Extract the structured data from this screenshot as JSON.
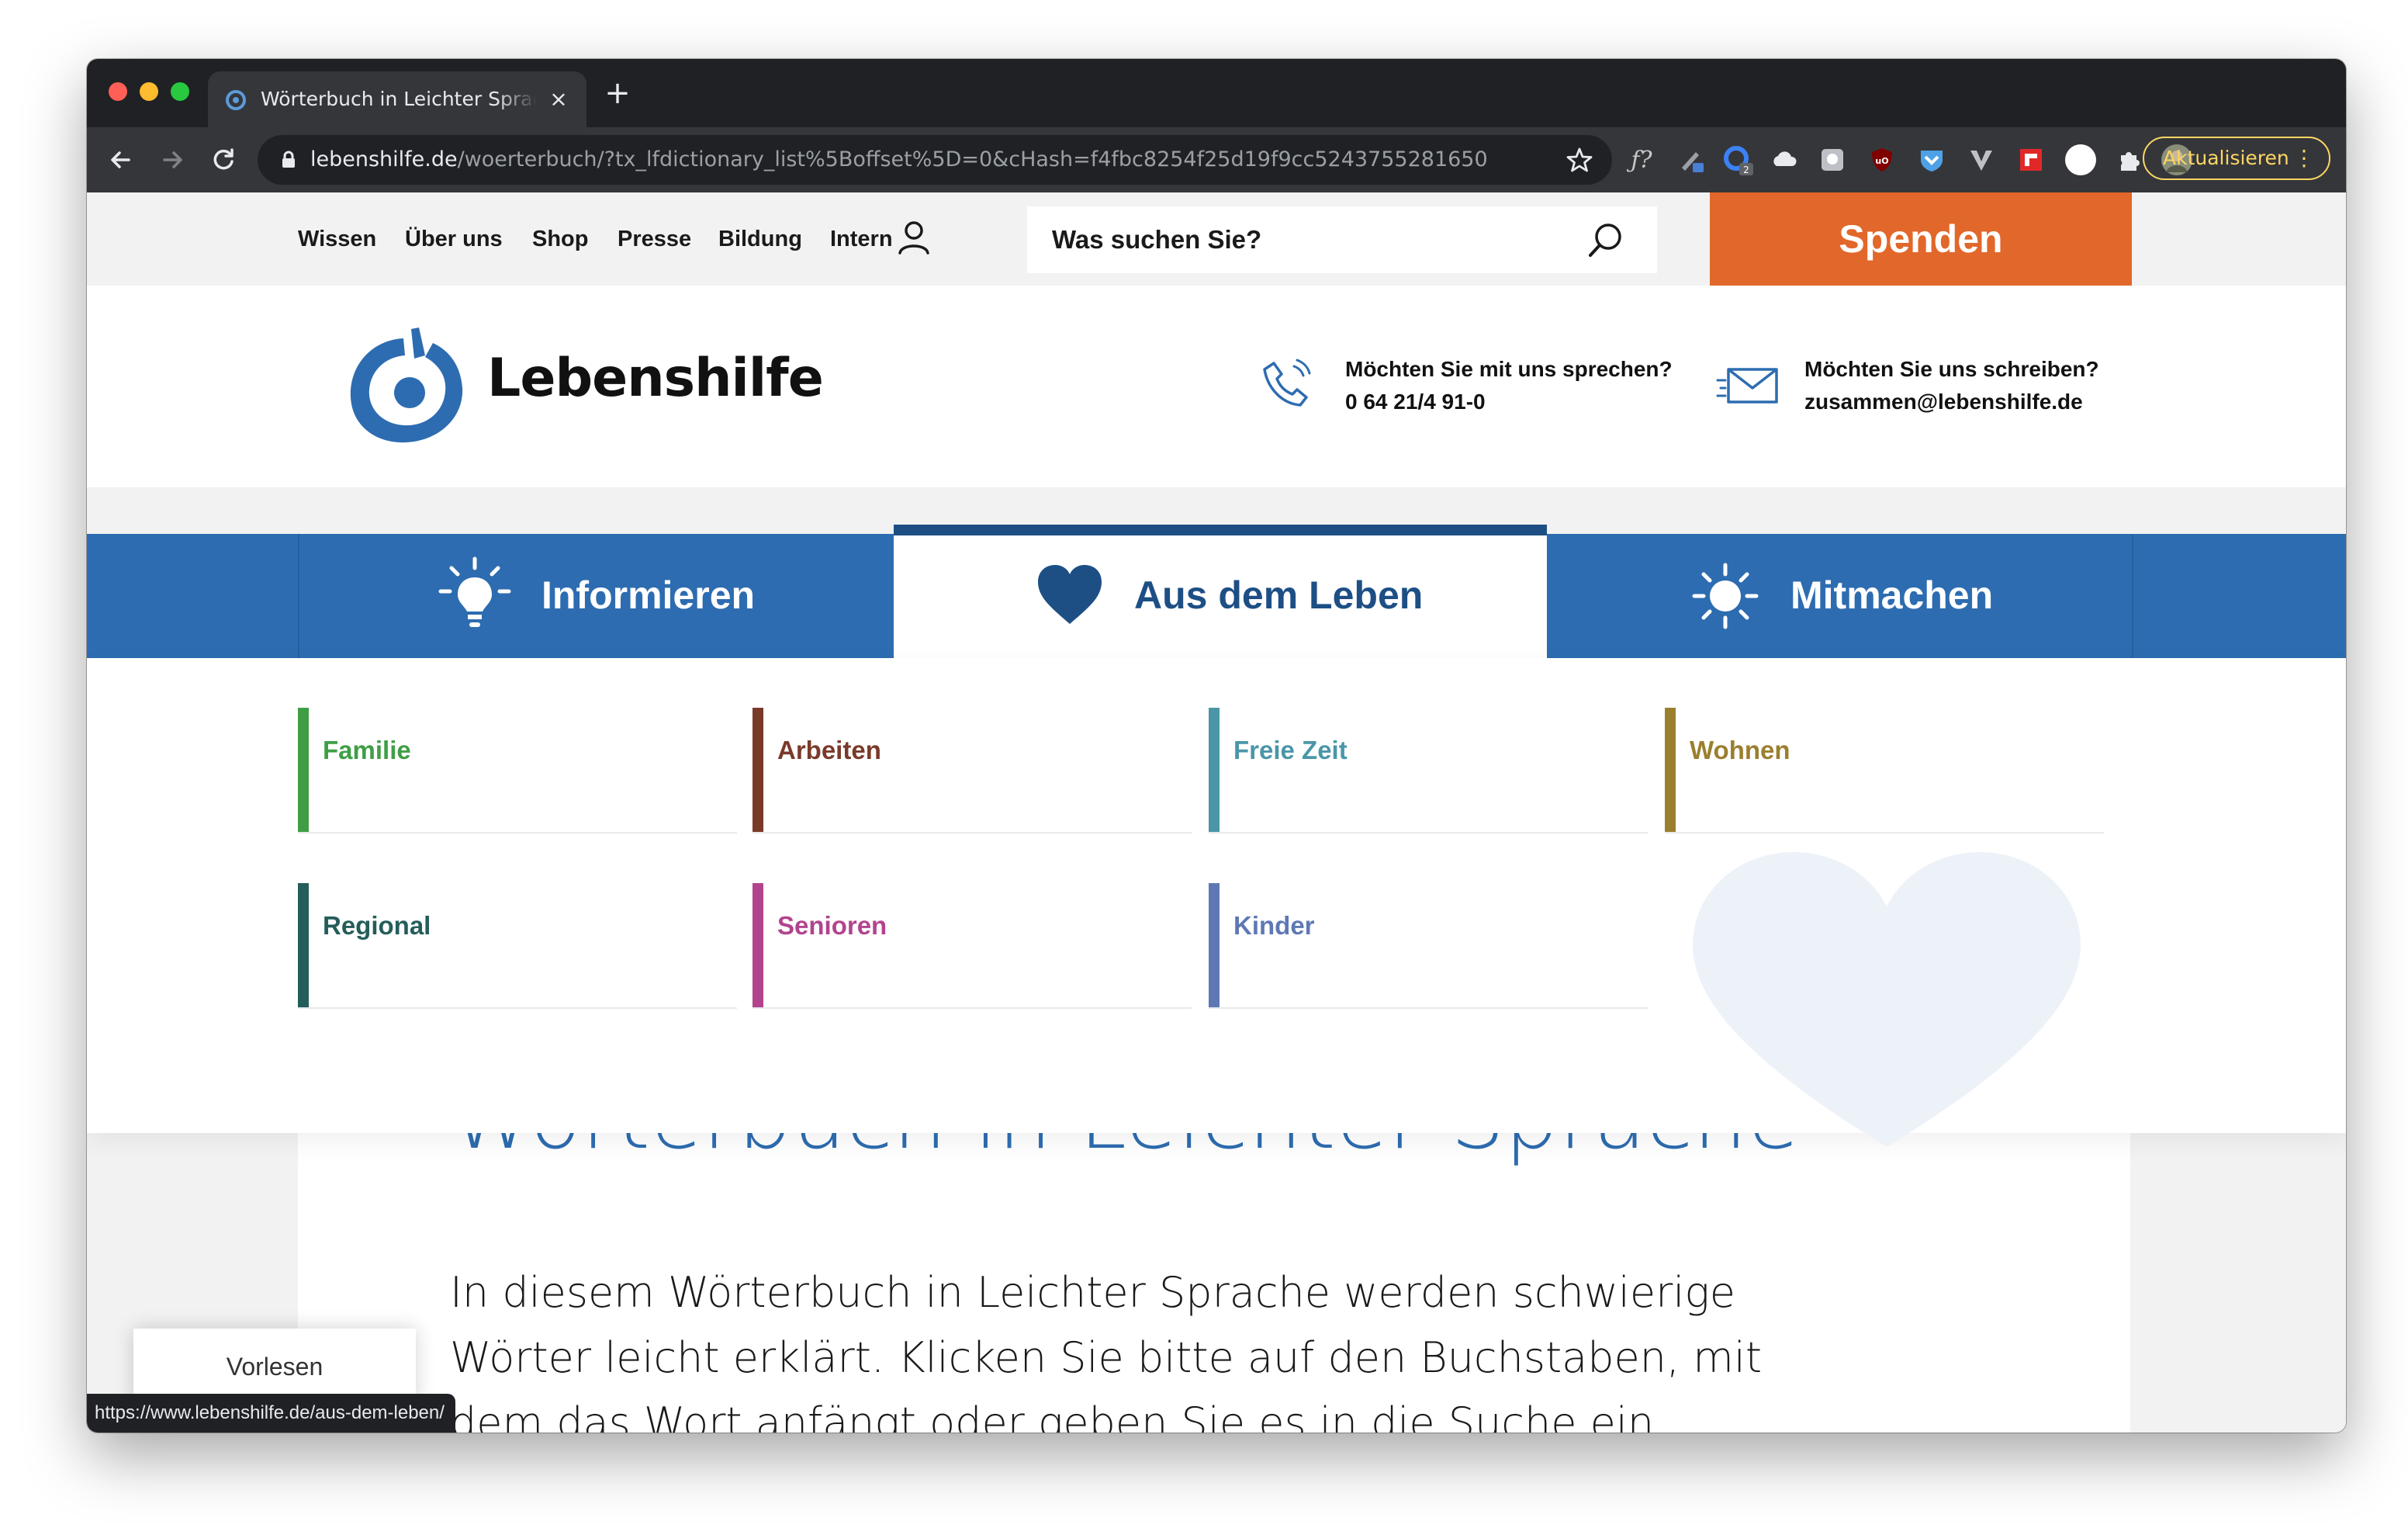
{
  "browser": {
    "tab_title": "Wörterbuch in Leichter Sprache – Lebenshilfe",
    "close_glyph": "×",
    "newtab_glyph": "+",
    "url_domain": "lebenshilfe.de",
    "url_path": "/woerterbuch/?tx_lfdictionary_list%5Boffset%5D=0&cHash=f4fbc8254f25d19f9cc5243755281650",
    "update_button": "Aktualisieren",
    "status_url": "https://www.lebenshilfe.de/aus-dem-leben/"
  },
  "topnav": {
    "items": [
      "Wissen",
      "Über uns",
      "Shop",
      "Presse",
      "Bildung",
      "Intern"
    ],
    "search_placeholder": "Was suchen Sie?",
    "donate": "Spenden"
  },
  "header": {
    "logo_text": "Lebenshilfe",
    "phone_question": "Möchten Sie mit uns sprechen?",
    "phone_number": "0 64 21/4 91-0",
    "mail_question": "Möchten Sie uns schreiben?",
    "mail_address": "zusammen@lebenshilfe.de"
  },
  "mainnav": {
    "tabs": [
      {
        "label": "Informieren",
        "icon": "lightbulb-icon"
      },
      {
        "label": "Aus dem Leben",
        "icon": "heart-icon",
        "active": true
      },
      {
        "label": "Mitmachen",
        "icon": "sun-icon"
      }
    ]
  },
  "categories": [
    {
      "label": "Familie",
      "color": "#3f9e45"
    },
    {
      "label": "Arbeiten",
      "color": "#7a3a2a"
    },
    {
      "label": "Freie Zeit",
      "color": "#4a96a8"
    },
    {
      "label": "Wohnen",
      "color": "#9b7f2e"
    },
    {
      "label": "Regional",
      "color": "#245d5a"
    },
    {
      "label": "Senioren",
      "color": "#b2448e"
    },
    {
      "label": "Kinder",
      "color": "#5f78b4"
    }
  ],
  "content": {
    "title": "Wörterbuch in Leichter Sprache",
    "intro": "In diesem Wörterbuch in Leichter Sprache werden schwierige Wörter leicht erklärt. Klicken Sie bitte auf den Buchstaben, mit dem das Wort anfängt oder geben Sie es in die Suche ein.",
    "read_button": "Vorlesen"
  },
  "colors": {
    "brand_blue": "#2d6cb0",
    "donate_orange": "#e2672a",
    "chrome_dark": "#202124"
  }
}
